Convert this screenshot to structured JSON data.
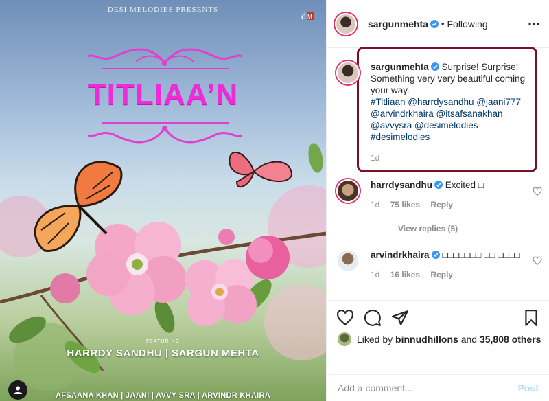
{
  "poster": {
    "presents": "DESI MELODIES PRESENTS",
    "title": "TITLIAA’N",
    "featuring": "FEATURING",
    "cast": "HARRDY SANDHU | SARGUN MEHTA",
    "credits": "AFSAANA KHAN | JAANI | AVVY SRA | ARVINDR KHAIRA",
    "logo_text": "DM"
  },
  "header": {
    "username": "sargunmehta",
    "separator": "•",
    "following_label": "Following",
    "more_icon": "more-horizontal-icon"
  },
  "caption": {
    "username": "sargunmehta",
    "text": "Surprise! Surprise! Something very very beautiful coming your way.",
    "tags_line1": "#Titliaan @harrdysandhu @jaani777",
    "tags_line2": "@arvindrkhaira @itsafsanakhan",
    "tags_line3": "@avvysra @desimelodies",
    "tags_line4": "#desimelodies",
    "time": "1d"
  },
  "comments": [
    {
      "username": "harrdysandhu",
      "text": "Excited □",
      "time": "1d",
      "likes": "75 likes",
      "reply_label": "Reply"
    },
    {
      "username": "arvindrkhaira",
      "text": "□□□□□□□ □□ □□□□",
      "time": "1d",
      "likes": "16 likes",
      "reply_label": "Reply"
    }
  ],
  "view_replies": "View replies (5)",
  "likes": {
    "prefix": "Liked by",
    "user": "binnudhillons",
    "and": "and",
    "others": "35,808 others"
  },
  "add_comment": {
    "placeholder": "Add a comment...",
    "post_label": "Post"
  },
  "colors": {
    "title_pink": "#f02ad8",
    "link": "#00376b",
    "verified_blue": "#3897f0",
    "highlight_box": "#7c1024",
    "post_disabled": "#b2dffc"
  }
}
